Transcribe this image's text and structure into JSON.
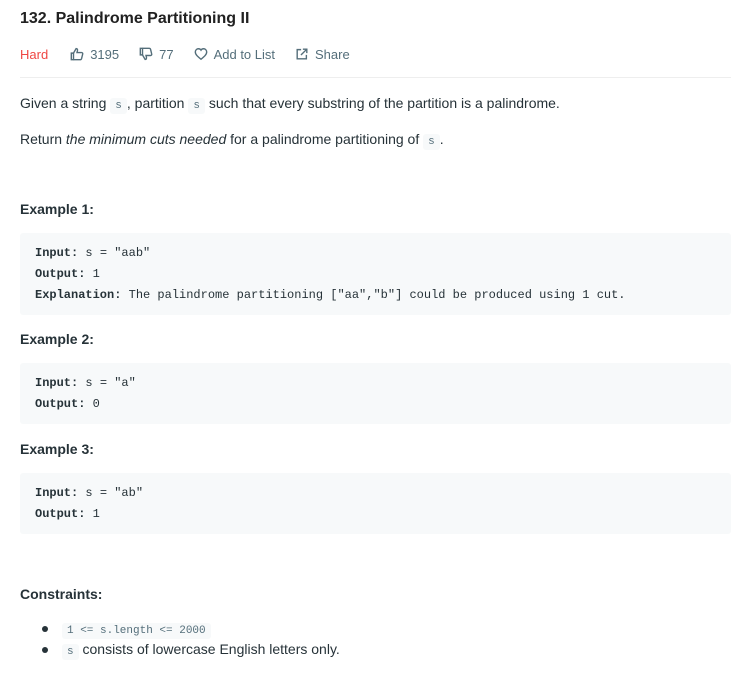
{
  "problem": {
    "title": "132. Palindrome Partitioning II",
    "difficulty": "Hard",
    "likes": "3195",
    "dislikes": "77",
    "add_to_list": "Add to List",
    "share": "Share"
  },
  "description": {
    "line1": {
      "pre": "Given a string ",
      "code1": "s",
      "mid": ", partition ",
      "code2": "s",
      "post": " such that every substring of the partition is a palindrome."
    },
    "line2": {
      "pre": "Return ",
      "em": "the minimum cuts needed",
      "mid": " for a palindrome partitioning of ",
      "code": "s",
      "post": "."
    }
  },
  "examples": [
    {
      "heading": "Example 1:",
      "input_label": "Input:",
      "input_value": " s = \"aab\"",
      "output_label": "Output:",
      "output_value": " 1",
      "explanation_label": "Explanation:",
      "explanation_value": " The palindrome partitioning [\"aa\",\"b\"] could be produced using 1 cut."
    },
    {
      "heading": "Example 2:",
      "input_label": "Input:",
      "input_value": " s = \"a\"",
      "output_label": "Output:",
      "output_value": " 0"
    },
    {
      "heading": "Example 3:",
      "input_label": "Input:",
      "input_value": " s = \"ab\"",
      "output_label": "Output:",
      "output_value": " 1"
    }
  ],
  "constraints": {
    "heading": "Constraints:",
    "item1_code": "1 <= s.length <= 2000",
    "item2_code": "s",
    "item2_text": " consists of lowercase English letters only."
  },
  "colors": {
    "difficulty_hard": "#ef4743",
    "code_background": "#f7f9fa"
  },
  "icons": {
    "likes": "thumbs-up-icon",
    "dislikes": "thumbs-down-icon",
    "add_to_list": "heart-icon",
    "share": "share-icon"
  }
}
